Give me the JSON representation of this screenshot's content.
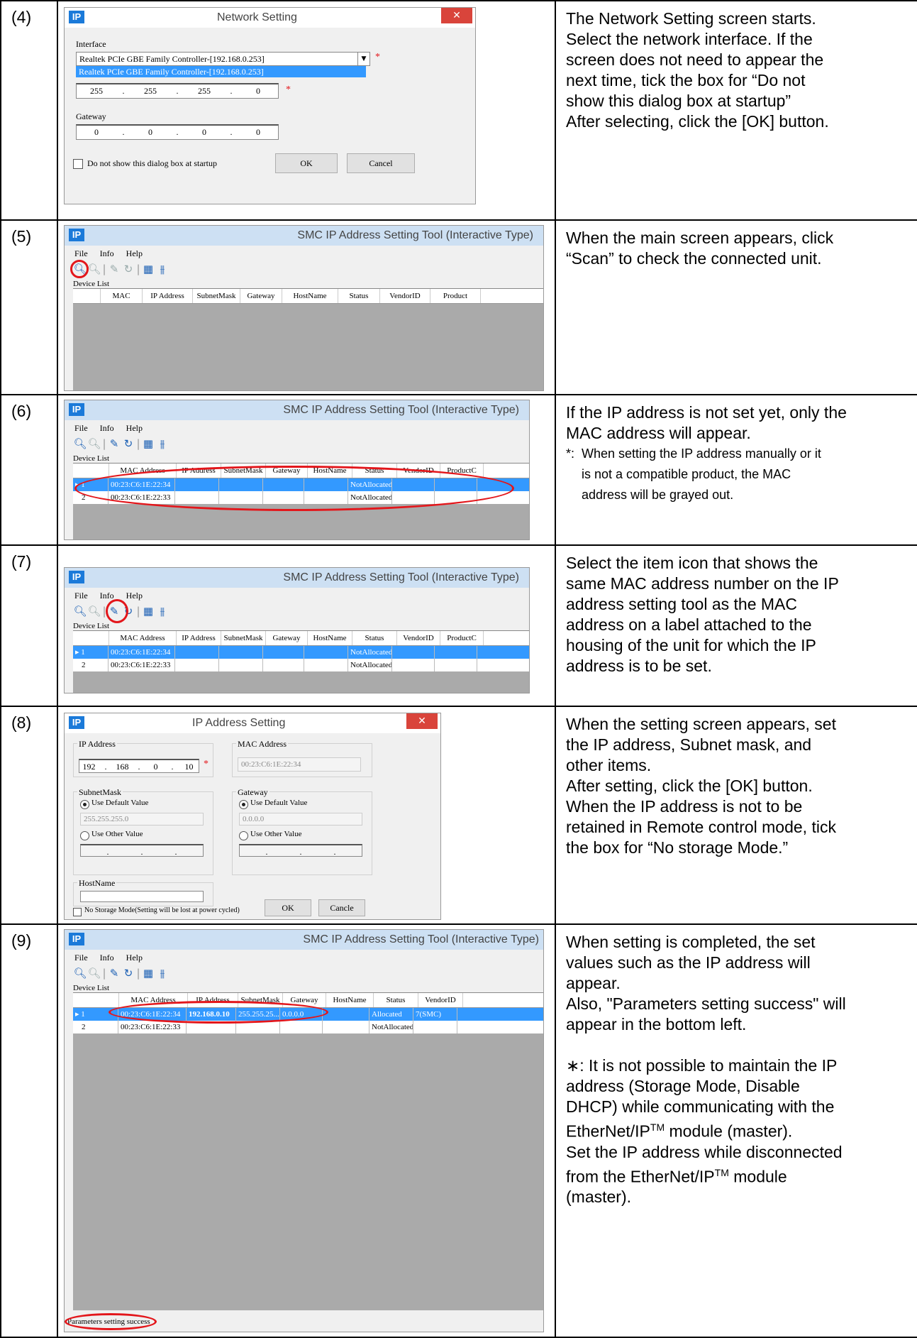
{
  "rows": [
    {
      "num": "(4)",
      "desc": [
        "The Network Setting screen starts.",
        "Select the network interface. If the",
        "screen does not need to appear the",
        "next time, tick the box for “Do not",
        "show this dialog box at startup”",
        "After selecting, click the [OK] button."
      ],
      "shot": {
        "title": "Network Setting",
        "interface_label": "Interface",
        "interface_value": "Realtek PCIe GBE Family Controller-[192.168.0.253]",
        "dropdown_option": "Realtek PCIe GBE Family Controller-[192.168.0.253]",
        "subnet": [
          "255",
          "255",
          "255",
          "0"
        ],
        "gateway_label": "Gateway",
        "gateway": [
          "0",
          "0",
          "0",
          "0"
        ],
        "checkbox_label": "Do not show this dialog box at startup",
        "ok": "OK",
        "cancel": "Cancel"
      }
    },
    {
      "num": "(5)",
      "desc": [
        "When the main screen appears, click",
        "“Scan” to check the connected unit."
      ]
    },
    {
      "num": "(6)",
      "desc": [
        "If the IP address is not set yet, only the",
        "MAC address will appear."
      ],
      "note_mark": "*:",
      "note": [
        "When setting the IP address manually or it",
        "is not a compatible product, the MAC",
        "address will be grayed out."
      ]
    },
    {
      "num": "(7)",
      "desc": [
        "Select the item icon that shows the",
        "same MAC address number on the IP",
        "address setting tool as the MAC",
        "address on a label attached to the",
        "housing of the unit for which the IP",
        "address is to be set."
      ]
    },
    {
      "num": "(8)",
      "desc": [
        "When the setting screen appears, set",
        "the IP address, Subnet mask, and",
        "other items.",
        "After setting, click the [OK] button.",
        "When the IP address is not to be",
        "retained in Remote control mode, tick",
        "the box for “No storage Mode.”"
      ],
      "shot": {
        "title": "IP Address Setting",
        "ip_label": "IP Address",
        "ip": [
          "192",
          "168",
          "0",
          "10"
        ],
        "mac_label": "MAC Address",
        "mac_value": "00:23:C6:1E:22:34",
        "subnet_label": "SubnetMask",
        "use_default": "Use Default Value",
        "subnet_default": "255.255.255.0",
        "use_other": "Use Other Value",
        "gateway_label": "Gateway",
        "gateway_default": "0.0.0.0",
        "hostname_label": "HostName",
        "storage_label": "No Storage Mode(Setting will be lost at power cycled)",
        "ok": "OK",
        "cancel": "Cancle"
      }
    },
    {
      "num": "(9)",
      "desc": [
        "When setting is completed, the set",
        "values such as the IP address will",
        "appear.",
        "Also, \"Parameters setting success\" will",
        "appear in the bottom left."
      ],
      "desc2": [
        "∗: It is not possible to maintain the IP",
        "address (Storage Mode, Disable",
        "DHCP) while communicating with the"
      ],
      "ethernet_a": "EtherNet/IP",
      "tm": "TM",
      "ethernet_a_rest": " module (master).",
      "desc3": "Set the IP address while disconnected",
      "ethernet_b_pre": "from the EtherNet/IP",
      "ethernet_b_rest": " module",
      "desc4": "(master).",
      "status_bar": "Parameters setting success"
    }
  ],
  "tool": {
    "title": "SMC IP Address Setting Tool (Interactive Type)",
    "menu": [
      "File",
      "Info",
      "Help"
    ],
    "device_list": "Device List",
    "columns5": [
      "",
      "MAC",
      "IP Address",
      "SubnetMask",
      "Gateway",
      "HostName",
      "Status",
      "VendorID",
      "Product"
    ],
    "columns": [
      "",
      "MAC Address",
      "IP Address",
      "SubnetMask",
      "Gateway",
      "HostName",
      "Status",
      "VendorID",
      "ProductC"
    ],
    "row1": [
      "1",
      "00:23:C6:1E:22:34",
      "",
      "",
      "",
      "",
      "NotAllocated",
      "",
      ""
    ],
    "row2": [
      "2",
      "00:23:C6:1E:22:33",
      "",
      "",
      "",
      "",
      "NotAllocated",
      "",
      ""
    ],
    "row1_done": [
      "1",
      "00:23:C6:1E:22:34",
      "192.168.0.10",
      "255.255.25...",
      "0.0.0.0",
      "",
      "Allocated",
      "7(SMC)",
      ""
    ],
    "row2_done": [
      "2",
      "00:23:C6:1E:22:33",
      "",
      "",
      "",
      "",
      "NotAllocated",
      "",
      ""
    ]
  },
  "icons": [
    "scan-icon",
    "search-disabled-icon",
    "edit-icon",
    "refresh-icon",
    "grid-icon",
    "settings-icon"
  ],
  "colors": {
    "selection": "#3399ff",
    "highlight_oval": "#e3161b",
    "close_button": "#d9443b",
    "title_blue": "#cde0f3"
  }
}
